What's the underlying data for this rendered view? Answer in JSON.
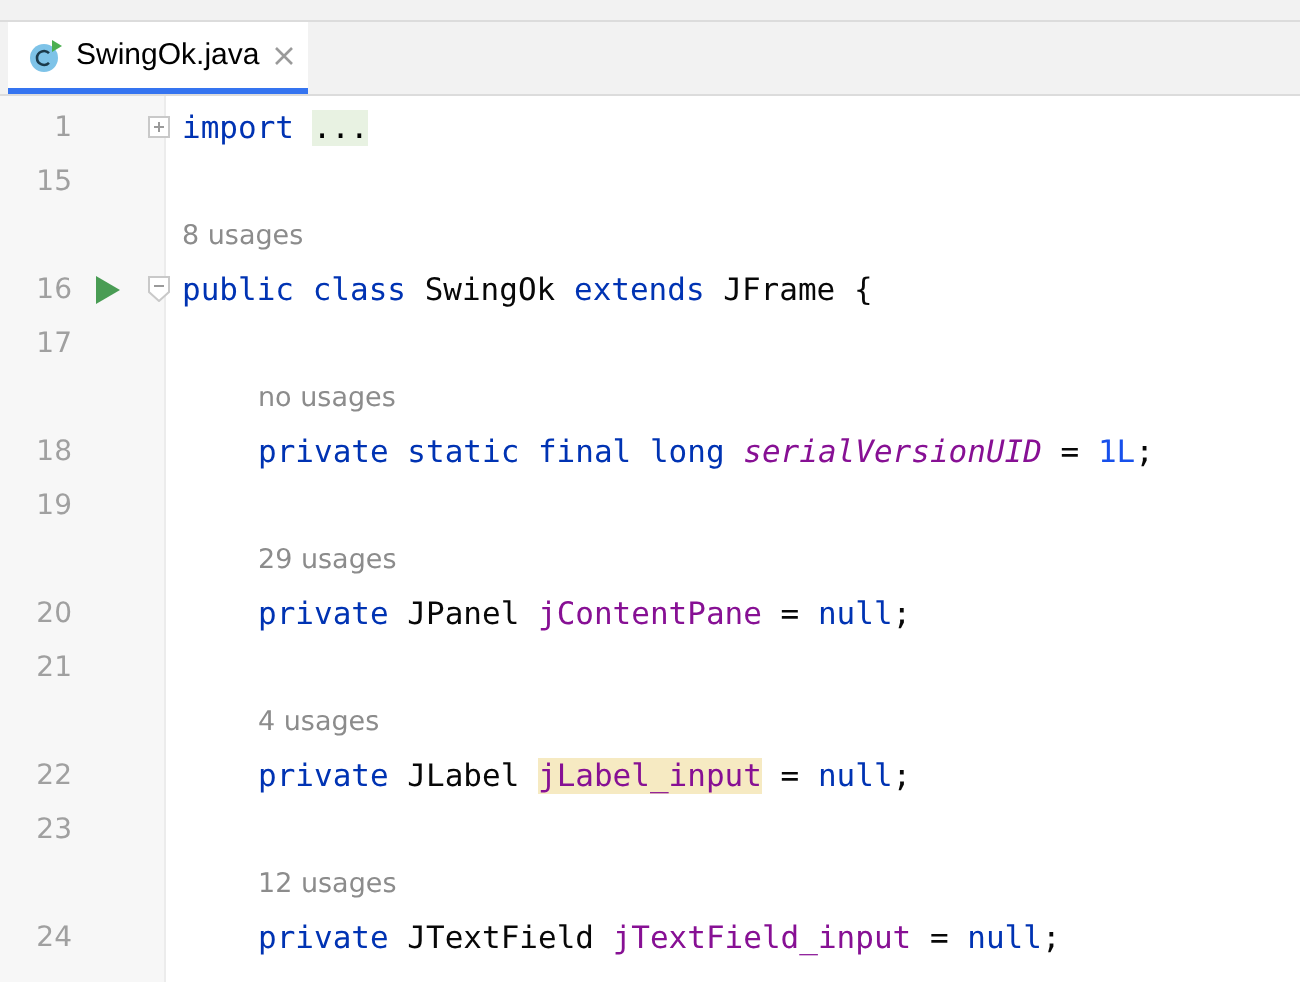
{
  "tab": {
    "label": "SwingOk.java",
    "selected": true
  },
  "lines": [
    {
      "kind": "code",
      "number": "1",
      "collapsed": true,
      "tokens": [
        {
          "text": "import ",
          "kind": "keyword"
        },
        {
          "text": "...",
          "kind": "folded"
        }
      ]
    },
    {
      "kind": "code",
      "number": "15"
    },
    {
      "kind": "usages",
      "text": "8 usages"
    },
    {
      "kind": "code",
      "number": "16",
      "collapsed": false,
      "run": true,
      "tokens": [
        {
          "text": "public class",
          "kind": "keyword"
        },
        {
          "text": " SwingOk ",
          "kind": "plain"
        },
        {
          "text": "extends",
          "kind": "keyword"
        },
        {
          "text": " JFrame {",
          "kind": "plain"
        }
      ],
      "children": [
        {
          "kind": "code",
          "number": "17"
        },
        {
          "kind": "usages",
          "text": "no usages"
        },
        {
          "kind": "code",
          "number": "18",
          "tokens": [
            {
              "text": "private static final long ",
              "kind": "keyword"
            },
            {
              "text": "serialVersionUID",
              "kind": "static-field"
            },
            {
              "text": " = ",
              "kind": "plain"
            },
            {
              "text": "1L",
              "kind": "number"
            },
            {
              "text": ";",
              "kind": "plain"
            }
          ]
        },
        {
          "kind": "code",
          "number": "19"
        },
        {
          "kind": "usages",
          "text": "29 usages"
        },
        {
          "kind": "code",
          "number": "20",
          "tokens": [
            {
              "text": "private",
              "kind": "keyword"
            },
            {
              "text": " JPanel ",
              "kind": "plain"
            },
            {
              "text": "jContentPane",
              "kind": "field"
            },
            {
              "text": " = ",
              "kind": "plain"
            },
            {
              "text": "null",
              "kind": "keyword"
            },
            {
              "text": ";",
              "kind": "plain"
            }
          ]
        },
        {
          "kind": "code",
          "number": "21"
        },
        {
          "kind": "usages",
          "text": "4 usages"
        },
        {
          "kind": "code",
          "number": "22",
          "tokens": [
            {
              "text": "private",
              "kind": "keyword"
            },
            {
              "text": " JLabel ",
              "kind": "plain"
            },
            {
              "text": "jLabel_input",
              "kind": "field",
              "highlighted": true
            },
            {
              "text": " = ",
              "kind": "plain"
            },
            {
              "text": "null",
              "kind": "keyword"
            },
            {
              "text": ";",
              "kind": "plain"
            }
          ]
        },
        {
          "kind": "code",
          "number": "23"
        },
        {
          "kind": "usages",
          "text": "12 usages"
        },
        {
          "kind": "code",
          "number": "24",
          "tokens": [
            {
              "text": "private",
              "kind": "keyword"
            },
            {
              "text": " JTextField ",
              "kind": "plain"
            },
            {
              "text": "jTextField_input",
              "kind": "field"
            },
            {
              "text": " = ",
              "kind": "plain"
            },
            {
              "text": "null",
              "kind": "keyword"
            },
            {
              "text": ";",
              "kind": "plain"
            }
          ]
        }
      ]
    }
  ]
}
